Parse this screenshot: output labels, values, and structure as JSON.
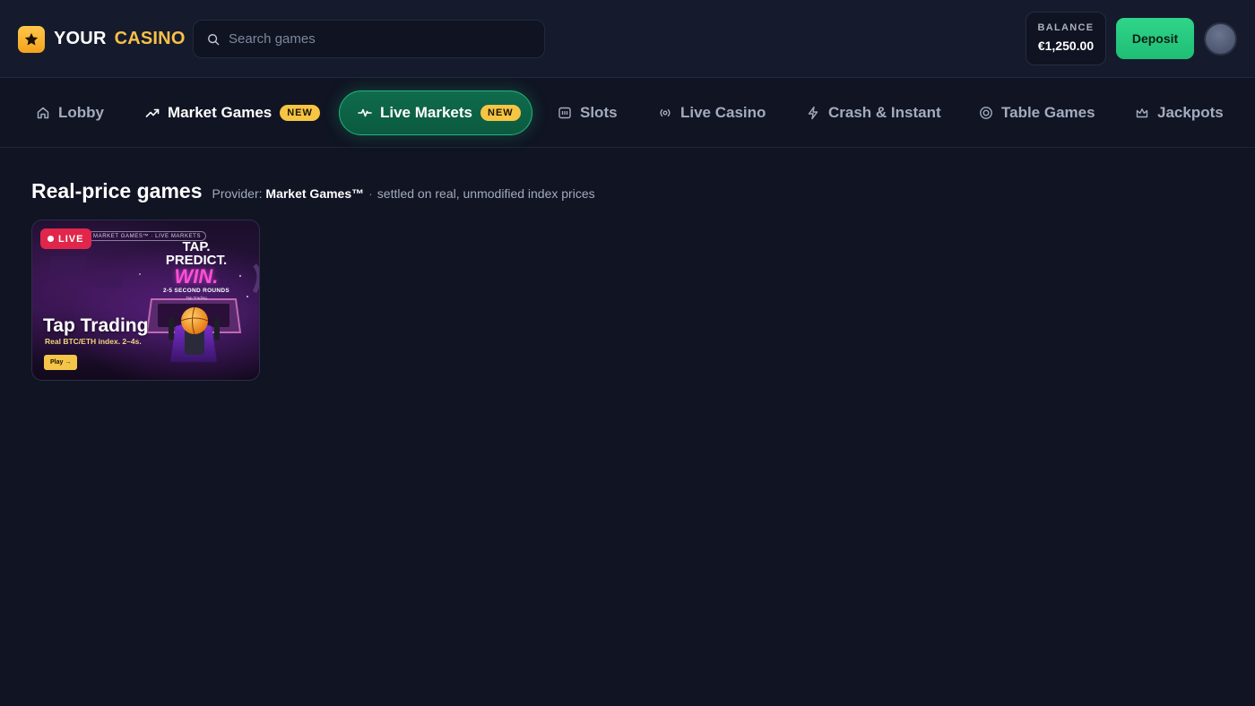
{
  "header": {
    "logo_icon": "star-icon",
    "logo_word1": "YOUR",
    "logo_word2": "CASINO",
    "search_placeholder": "Search games",
    "balance_label": "BALANCE",
    "balance_value": "€1,250.00",
    "deposit_label": "Deposit"
  },
  "nav": {
    "items": [
      {
        "label": "Lobby",
        "icon": "home-icon"
      },
      {
        "label": "Market Games",
        "icon": "trending-up-icon",
        "badge": "NEW"
      },
      {
        "label": "Live Markets",
        "icon": "pulse-icon",
        "badge": "NEW",
        "active": true
      },
      {
        "label": "Slots",
        "icon": "slots-icon"
      },
      {
        "label": "Live Casino",
        "icon": "broadcast-icon"
      },
      {
        "label": "Crash & Instant",
        "icon": "lightning-icon"
      },
      {
        "label": "Table Games",
        "icon": "chip-icon"
      },
      {
        "label": "Jackpots",
        "icon": "crown-icon"
      }
    ]
  },
  "section": {
    "title": "Real-price games",
    "provider_prefix": "Provider:",
    "provider_name": "Market Games™",
    "separator": "·",
    "provider_suffix": "settled on real, unmodified index prices"
  },
  "games": [
    {
      "badge": "LIVE",
      "topline": "MARKET GAMES™ · LIVE MARKETS",
      "tagline_1": "TAP.",
      "tagline_2": "PREDICT.",
      "tagline_3": "WIN.",
      "tagline_4": "2-5 SECOND ROUNDS",
      "tagline_5": "Tap Trading",
      "title": "Tap Trading",
      "subtitle": "Real BTC/ETH index. 2–4s.",
      "play_label": "Play →"
    }
  ],
  "colors": {
    "background": "#101423",
    "accent_gold": "#f8c04a",
    "accent_green": "#2fd58a",
    "live_red": "#e0264a"
  }
}
